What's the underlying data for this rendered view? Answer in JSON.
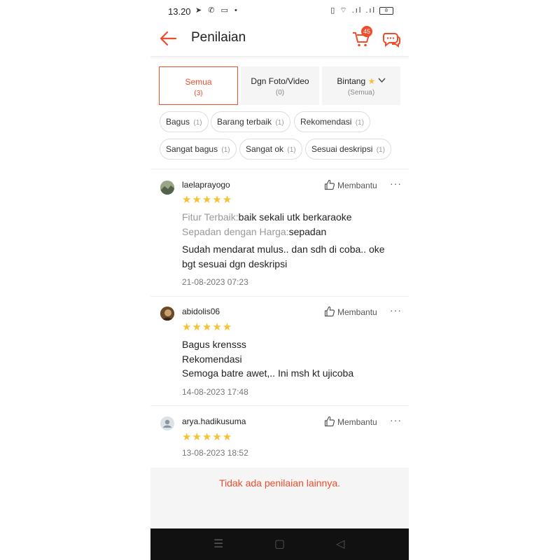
{
  "status_bar": {
    "time": "13.20",
    "left_icons": "➤ ✆ ▭ •",
    "right_icons": "▯ ⌔ .ıl .ıl",
    "battery": "8"
  },
  "header": {
    "title": "Penilaian",
    "cart_count": "45"
  },
  "filter_tabs": [
    {
      "label": "Semua",
      "count": "(3)",
      "active": true
    },
    {
      "label": "Dgn Foto/Video",
      "count": "(0)",
      "active": false
    },
    {
      "label": "Bintang",
      "count": "(Semua)",
      "active": false
    }
  ],
  "chips": [
    {
      "label": "Bagus",
      "count": "(1)"
    },
    {
      "label": "Barang terbaik",
      "count": "(1)"
    },
    {
      "label": "Rekomendasi",
      "count": "(1)"
    },
    {
      "label": "Sangat bagus",
      "count": "(1)"
    },
    {
      "label": "Sangat ok",
      "count": "(1)"
    },
    {
      "label": "Sesuai deskripsi",
      "count": "(1)"
    }
  ],
  "helpful_label": "Membantu",
  "reviews": [
    {
      "username": "laelaprayogo",
      "rating": 5,
      "stars": "★★★★★",
      "attributes": [
        {
          "label": "Fitur Terbaik:",
          "value": "baik sekali utk berkaraoke"
        },
        {
          "label": "Sepadan dengan Harga:",
          "value": "sepadan"
        }
      ],
      "text_lines": [
        "Sudah mendarat mulus.. dan sdh di coba.. oke",
        "bgt sesuai dgn deskripsi"
      ],
      "date": "21-08-2023 07:23"
    },
    {
      "username": "abidolis06",
      "rating": 5,
      "stars": "★★★★★",
      "text_lines": [
        "Bagus krensss",
        "Rekomendasi",
        "Semoga batre awet,.. Ini msh kt ujicoba"
      ],
      "date": "14-08-2023 17:48"
    },
    {
      "username": "arya.hadikusuma",
      "rating": 5,
      "stars": "★★★★★",
      "text_lines": [],
      "date": "13-08-2023 18:52"
    }
  ],
  "end_message": "Tidak ada penilaian lainnya.",
  "colors": {
    "accent": "#ee4d2d",
    "star": "#f6c132"
  }
}
